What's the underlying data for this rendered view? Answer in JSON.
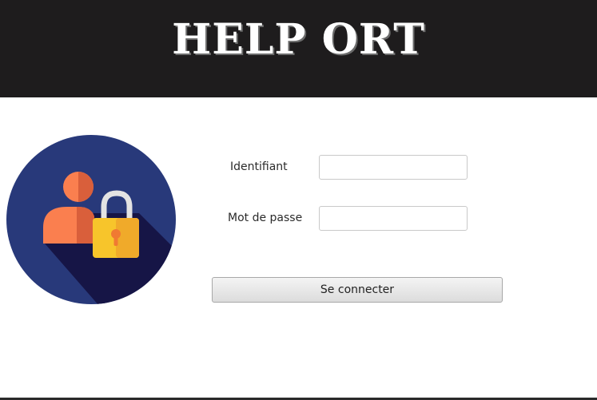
{
  "header": {
    "title": "HELP ORT",
    "background_color": "#1e1c1d"
  },
  "login_graphic": {
    "icon": "user-lock-icon",
    "colors": {
      "circle": "#28397a",
      "shadow": "#161546",
      "user": "#fa7f4f",
      "lock_body": "#f7c52b",
      "lock_shackle": "#e3e3e3"
    }
  },
  "form": {
    "username_label": "Identifiant",
    "username_value": "",
    "password_label": "Mot de passe",
    "password_value": "",
    "submit_label": "Se connecter"
  }
}
